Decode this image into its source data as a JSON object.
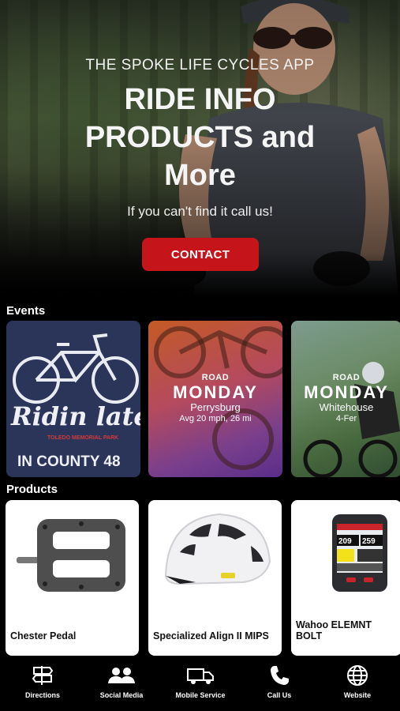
{
  "hero": {
    "eyebrow": "THE SPOKE LIFE CYCLES APP",
    "title_line1": "RIDE INFO",
    "title_line2": "PRODUCTS and",
    "title_line3": "More",
    "subtitle": "If you can't find it call us!",
    "contact_label": "CONTACT",
    "accent_color": "#c6141b"
  },
  "events": {
    "heading": "Events",
    "items": [
      {
        "line1": "Ridin late",
        "line2": "TOLEDO MEMORIAL PARK",
        "line3": "IN COUNTY 48"
      },
      {
        "road": "ROAD",
        "day": "MONDAY",
        "place": "Perrysburg",
        "detail": "Avg 20 mph, 26 mi"
      },
      {
        "road": "ROAD",
        "day": "MONDAY",
        "place": "Whitehouse",
        "detail": "4-Fer"
      }
    ]
  },
  "products": {
    "heading": "Products",
    "items": [
      {
        "name": "Chester Pedal",
        "icon": "pedal-image"
      },
      {
        "name": "Specialized Align II MIPS",
        "icon": "helmet-image"
      },
      {
        "name": "Wahoo ELEMNT BOLT",
        "icon": "bike-computer-image",
        "screen_top_left": "209",
        "screen_top_right": "259"
      }
    ]
  },
  "nav": {
    "items": [
      {
        "label": "Directions",
        "icon": "signpost-icon"
      },
      {
        "label": "Social Media",
        "icon": "people-icon"
      },
      {
        "label": "Mobile Service",
        "icon": "truck-icon"
      },
      {
        "label": "Call Us",
        "icon": "phone-icon"
      },
      {
        "label": "Website",
        "icon": "globe-icon"
      }
    ]
  }
}
